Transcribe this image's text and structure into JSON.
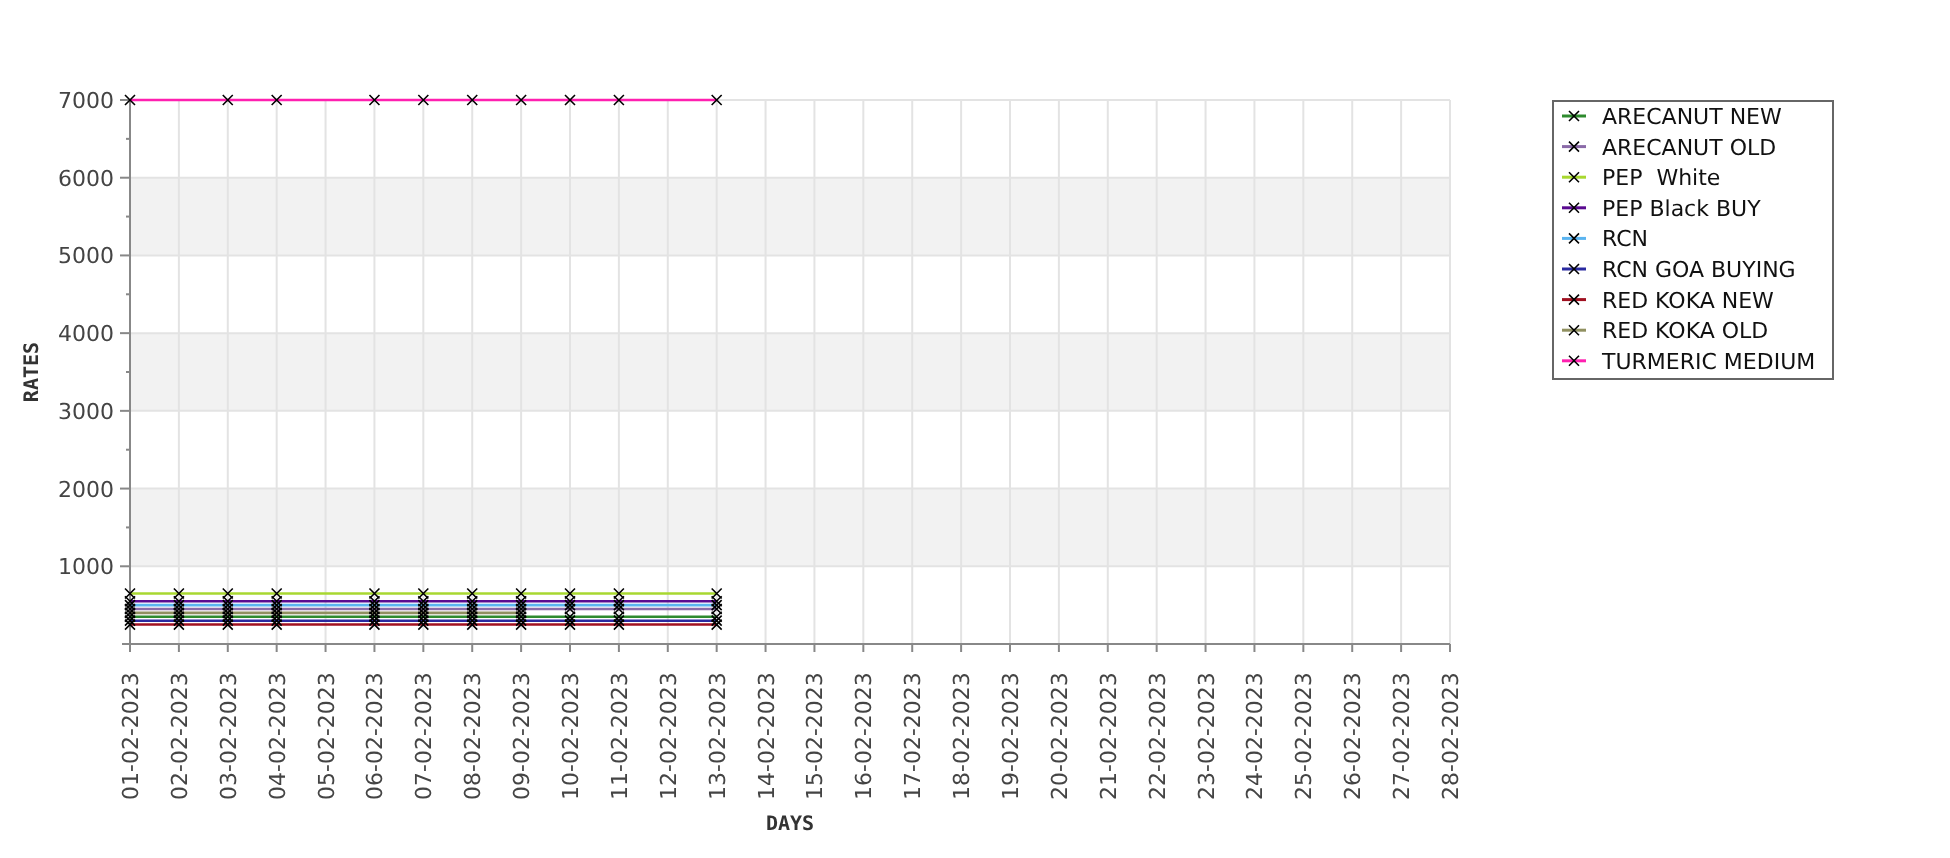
{
  "chart": {
    "chart_data": {
      "type": "line",
      "xlabel": "DAYS",
      "ylabel": "RATES",
      "grid": true,
      "legend": true,
      "categories": [
        "01-02-2023",
        "02-02-2023",
        "03-02-2023",
        "04-02-2023",
        "05-02-2023",
        "06-02-2023",
        "07-02-2023",
        "08-02-2023",
        "09-02-2023",
        "10-02-2023",
        "11-02-2023",
        "12-02-2023",
        "13-02-2023",
        "14-02-2023",
        "15-02-2023",
        "16-02-2023",
        "17-02-2023",
        "18-02-2023",
        "19-02-2023",
        "20-02-2023",
        "21-02-2023",
        "22-02-2023",
        "23-02-2023",
        "24-02-2023",
        "25-02-2023",
        "26-02-2023",
        "27-02-2023",
        "28-02-2023"
      ],
      "ylim": [
        0,
        7000
      ],
      "yticks": [
        1000,
        2000,
        3000,
        4000,
        5000,
        6000,
        7000
      ],
      "series": [
        {
          "name": "ARECANUT NEW",
          "color": "#2e8b2e",
          "marker": "x",
          "values": [
            350,
            350,
            350,
            350,
            null,
            350,
            350,
            350,
            350,
            350,
            350,
            null,
            350,
            null,
            null,
            null,
            null,
            null,
            null,
            null,
            null,
            null,
            null,
            null,
            null,
            null,
            null,
            null
          ]
        },
        {
          "name": "ARECANUT OLD",
          "color": "#8a6aa8",
          "marker": "x",
          "values": [
            450,
            450,
            450,
            450,
            null,
            450,
            450,
            450,
            450,
            450,
            450,
            null,
            450,
            null,
            null,
            null,
            null,
            null,
            null,
            null,
            null,
            null,
            null,
            null,
            null,
            null,
            null,
            null
          ]
        },
        {
          "name": "PEP  White",
          "color": "#a8d830",
          "marker": "x",
          "values": [
            650,
            650,
            650,
            650,
            null,
            650,
            650,
            650,
            650,
            650,
            650,
            null,
            650,
            null,
            null,
            null,
            null,
            null,
            null,
            null,
            null,
            null,
            null,
            null,
            null,
            null,
            null,
            null
          ]
        },
        {
          "name": "PEP Black BUY",
          "color": "#5a0a90",
          "marker": "x",
          "values": [
            550,
            550,
            550,
            550,
            null,
            550,
            550,
            550,
            550,
            550,
            550,
            null,
            550,
            null,
            null,
            null,
            null,
            null,
            null,
            null,
            null,
            null,
            null,
            null,
            null,
            null,
            null,
            null
          ]
        },
        {
          "name": "RCN",
          "color": "#5ab4f0",
          "marker": "x",
          "values": [
            500,
            500,
            500,
            500,
            null,
            500,
            500,
            500,
            500,
            500,
            500,
            null,
            500,
            null,
            null,
            null,
            null,
            null,
            null,
            null,
            null,
            null,
            null,
            null,
            null,
            null,
            null,
            null
          ]
        },
        {
          "name": "RCN GOA BUYING",
          "color": "#2a2aa0",
          "marker": "x",
          "values": [
            300,
            300,
            300,
            300,
            null,
            300,
            300,
            300,
            300,
            300,
            300,
            null,
            300,
            null,
            null,
            null,
            null,
            null,
            null,
            null,
            null,
            null,
            null,
            null,
            null,
            null,
            null,
            null
          ]
        },
        {
          "name": "RED KOKA NEW",
          "color": "#a01020",
          "marker": "x",
          "values": [
            250,
            250,
            250,
            250,
            null,
            250,
            250,
            250,
            250,
            250,
            250,
            null,
            250,
            null,
            null,
            null,
            null,
            null,
            null,
            null,
            null,
            null,
            null,
            null,
            null,
            null,
            null,
            null
          ]
        },
        {
          "name": "RED KOKA OLD",
          "color": "#909060",
          "marker": "x",
          "values": [
            400,
            400,
            400,
            400,
            null,
            400,
            400,
            400,
            400,
            null,
            null,
            null,
            null,
            null,
            null,
            null,
            null,
            null,
            null,
            null,
            null,
            null,
            null,
            null,
            null,
            null,
            null,
            null
          ]
        },
        {
          "name": "TURMERIC MEDIUM",
          "color": "#ff20b0",
          "marker": "x",
          "values": [
            7000,
            null,
            7000,
            7000,
            null,
            7000,
            7000,
            7000,
            7000,
            7000,
            7000,
            null,
            7000,
            null,
            null,
            null,
            null,
            null,
            null,
            null,
            null,
            null,
            null,
            null,
            null,
            null,
            null,
            null
          ]
        }
      ]
    }
  }
}
